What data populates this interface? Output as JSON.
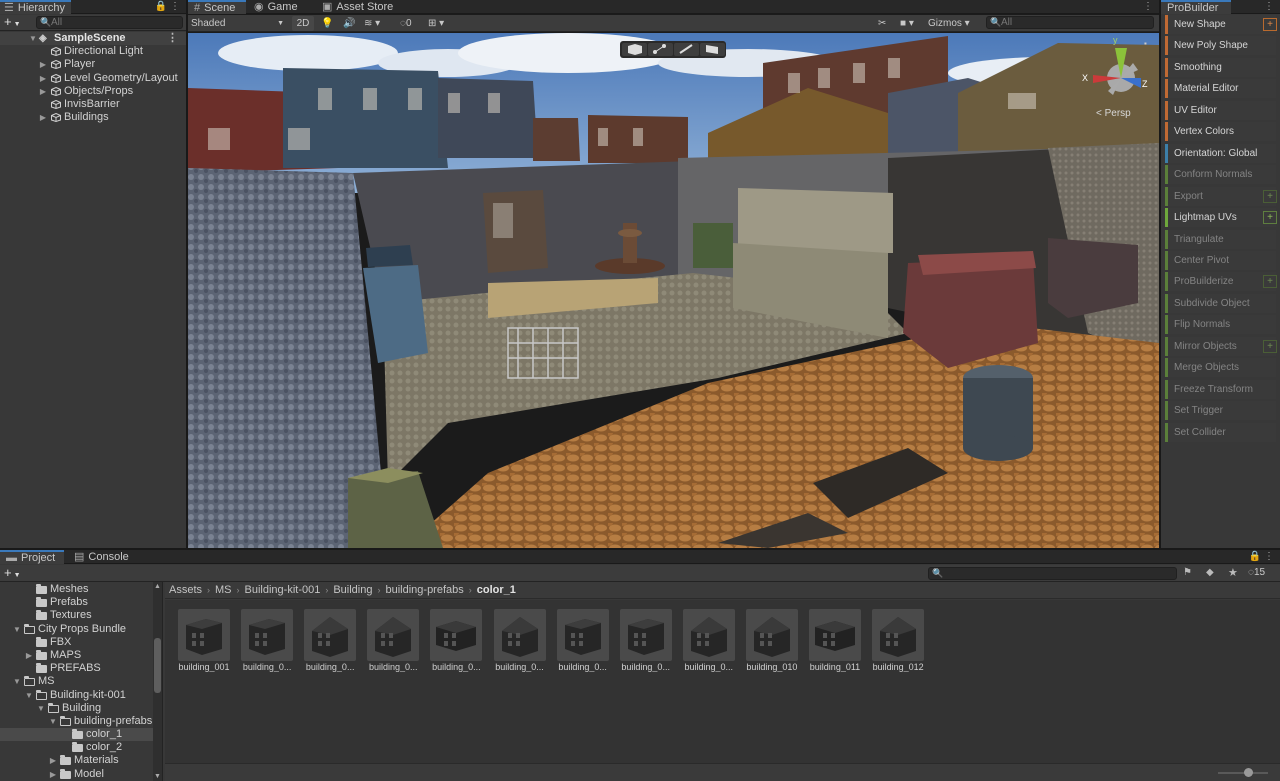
{
  "hierarchy": {
    "tab": "Hierarchy",
    "search_placeholder": "All",
    "scene": "SampleScene",
    "items": [
      {
        "label": "Directional Light",
        "expandable": false
      },
      {
        "label": "Player",
        "expandable": true
      },
      {
        "label": "Level Geometry/Layout",
        "expandable": true
      },
      {
        "label": "Objects/Props",
        "expandable": true
      },
      {
        "label": "InvisBarrier",
        "expandable": false
      },
      {
        "label": "Buildings",
        "expandable": true
      }
    ]
  },
  "scene_view": {
    "tabs": [
      "Scene",
      "Game",
      "Asset Store"
    ],
    "shading_mode": "Shaded",
    "mode_2d": "2D",
    "hidden_count": "0",
    "gizmos": "Gizmos",
    "search_placeholder": "All",
    "projection": "Persp",
    "axis_labels": {
      "x": "X",
      "y": "y",
      "z": "Z"
    }
  },
  "probuilder": {
    "tab": "ProBuilder",
    "buttons": [
      {
        "label": "New Shape",
        "style": "orange",
        "plus": true
      },
      {
        "label": "New Poly Shape",
        "style": "orange",
        "plus": false
      },
      {
        "label": "Smoothing",
        "style": "orange",
        "plus": false
      },
      {
        "label": "Material Editor",
        "style": "orange",
        "plus": false
      },
      {
        "label": "UV Editor",
        "style": "orange",
        "plus": false
      },
      {
        "label": "Vertex Colors",
        "style": "orange",
        "plus": false
      },
      {
        "label": "Orientation: Global",
        "style": "blue",
        "plus": false
      },
      {
        "label": "Conform Normals",
        "style": "green",
        "plus": false
      },
      {
        "label": "Export",
        "style": "green",
        "plus": true
      },
      {
        "label": "Lightmap UVs",
        "style": "greenact",
        "plus": true
      },
      {
        "label": "Triangulate",
        "style": "green",
        "plus": false
      },
      {
        "label": "Center Pivot",
        "style": "green",
        "plus": false
      },
      {
        "label": "ProBuilderize",
        "style": "green",
        "plus": true
      },
      {
        "label": "Subdivide Object",
        "style": "green",
        "plus": false
      },
      {
        "label": "Flip Normals",
        "style": "green",
        "plus": false
      },
      {
        "label": "Mirror Objects",
        "style": "green",
        "plus": true
      },
      {
        "label": "Merge Objects",
        "style": "green",
        "plus": false
      },
      {
        "label": "Freeze Transform",
        "style": "green",
        "plus": false
      },
      {
        "label": "Set Trigger",
        "style": "green",
        "plus": false
      },
      {
        "label": "Set Collider",
        "style": "green",
        "plus": false
      }
    ]
  },
  "project": {
    "tabs": [
      "Project",
      "Console"
    ],
    "hidden_count": "15",
    "folders": [
      {
        "label": "Meshes",
        "indent": 1,
        "arrow": "",
        "open": false,
        "selected": false
      },
      {
        "label": "Prefabs",
        "indent": 1,
        "arrow": "",
        "open": false,
        "selected": false
      },
      {
        "label": "Textures",
        "indent": 1,
        "arrow": "",
        "open": false,
        "selected": false
      },
      {
        "label": "City Props Bundle",
        "indent": 0,
        "arrow": "▼",
        "open": true,
        "selected": false
      },
      {
        "label": "FBX",
        "indent": 1,
        "arrow": "",
        "open": false,
        "selected": false
      },
      {
        "label": "MAPS",
        "indent": 1,
        "arrow": "▶",
        "open": false,
        "selected": false
      },
      {
        "label": "PREFABS",
        "indent": 1,
        "arrow": "",
        "open": false,
        "selected": false
      },
      {
        "label": "MS",
        "indent": 0,
        "arrow": "▼",
        "open": true,
        "selected": false
      },
      {
        "label": "Building-kit-001",
        "indent": 1,
        "arrow": "▼",
        "open": true,
        "selected": false
      },
      {
        "label": "Building",
        "indent": 2,
        "arrow": "▼",
        "open": true,
        "selected": false
      },
      {
        "label": "building-prefabs",
        "indent": 3,
        "arrow": "▼",
        "open": true,
        "selected": false
      },
      {
        "label": "color_1",
        "indent": 4,
        "arrow": "",
        "open": false,
        "selected": true
      },
      {
        "label": "color_2",
        "indent": 4,
        "arrow": "",
        "open": false,
        "selected": false
      },
      {
        "label": "Materials",
        "indent": 3,
        "arrow": "▶",
        "open": false,
        "selected": false
      },
      {
        "label": "Model",
        "indent": 3,
        "arrow": "▶",
        "open": false,
        "selected": false
      }
    ],
    "breadcrumb": [
      "Assets",
      "MS",
      "Building-kit-001",
      "Building",
      "building-prefabs",
      "color_1"
    ],
    "assets": [
      "building_001",
      "building_0...",
      "building_0...",
      "building_0...",
      "building_0...",
      "building_0...",
      "building_0...",
      "building_0...",
      "building_0...",
      "building_010",
      "building_011",
      "building_012"
    ],
    "zoom_fraction": 0.6
  },
  "colors": {
    "accent_blue": "#3a79bb",
    "probuilder_orange": "#c06a34",
    "probuilder_green": "#5b7f3a",
    "probuilder_blue": "#3d7fa8"
  }
}
